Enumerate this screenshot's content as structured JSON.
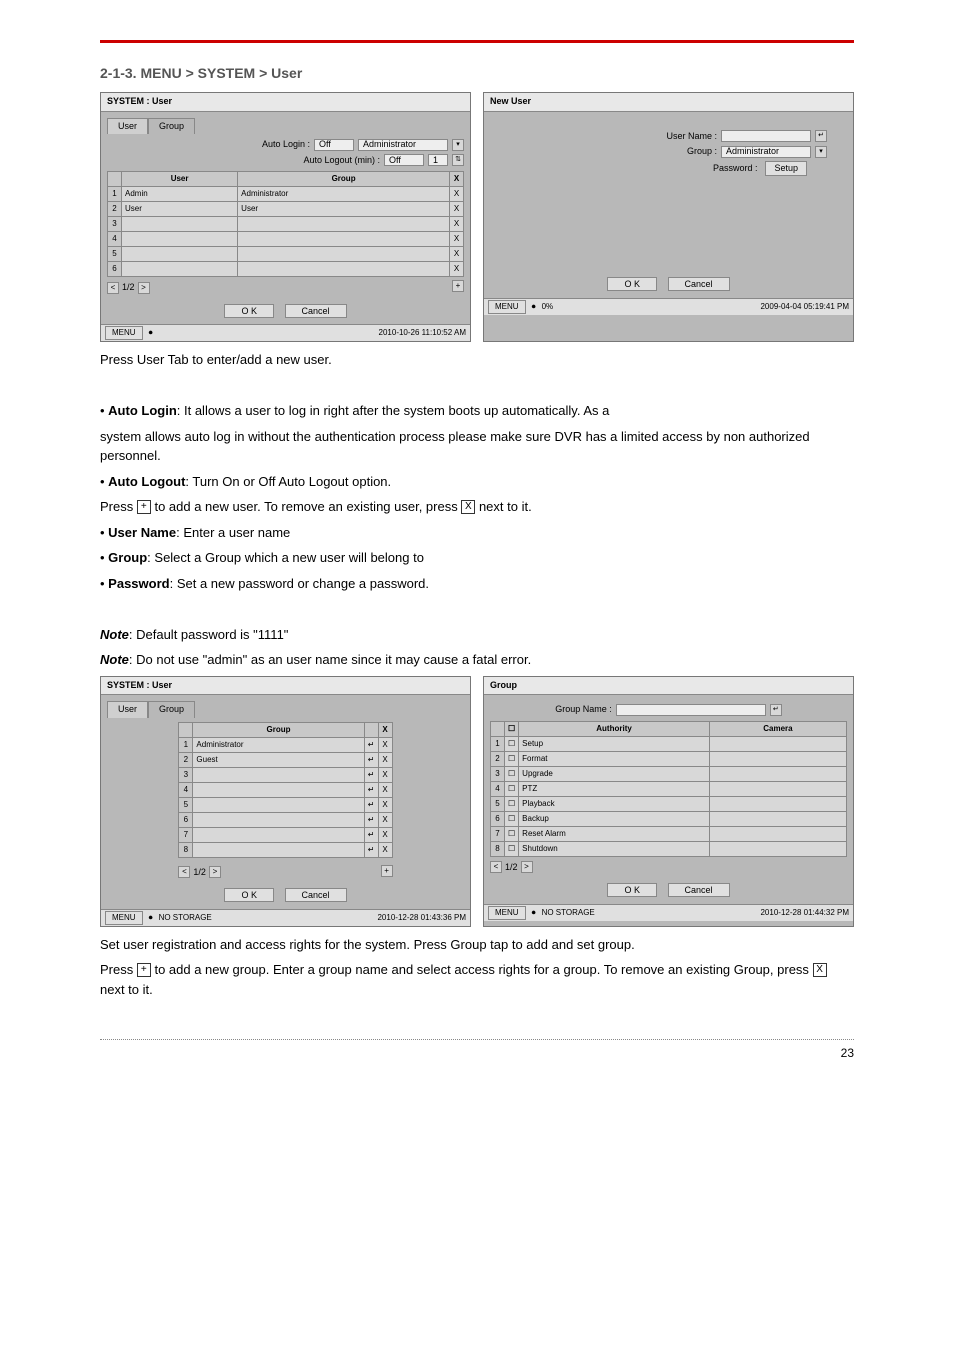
{
  "section_title": "2-1-3. MENU > SYSTEM > User",
  "shot1": {
    "title": "SYSTEM : User",
    "tab_user": "User",
    "tab_group": "Group",
    "auto_login_label": "Auto Login :",
    "auto_login_val": "Off",
    "auto_login_group": "Administrator",
    "auto_logout_label": "Auto Logout (min) :",
    "auto_logout_val": "Off",
    "auto_logout_num": "1",
    "col_user": "User",
    "col_group": "Group",
    "rows": [
      {
        "n": "1",
        "user": "Admin",
        "group": "Administrator"
      },
      {
        "n": "2",
        "user": "User",
        "group": "User"
      },
      {
        "n": "3",
        "user": "",
        "group": ""
      },
      {
        "n": "4",
        "user": "",
        "group": ""
      },
      {
        "n": "5",
        "user": "",
        "group": ""
      },
      {
        "n": "6",
        "user": "",
        "group": ""
      }
    ],
    "pager": "1/2",
    "ok": "O K",
    "cancel": "Cancel",
    "menu": "MENU",
    "ts": "2010-10-26 11:10:52 AM"
  },
  "shot2": {
    "title": "New User",
    "uname_label": "User Name :",
    "group_label": "Group :",
    "group_val": "Administrator",
    "pw_label": "Password :",
    "pw_btn": "Setup",
    "ok": "O K",
    "cancel": "Cancel",
    "menu": "MENU",
    "pct": "0%",
    "ts": "2009-04-04 05:19:41 PM"
  },
  "para1": "Press User Tab to enter/add a new user.",
  "bullets1": [
    {
      "b": "Auto Login",
      "t": ": It allows a user to log in right after the system boots up automatically. As a"
    }
  ],
  "para2": "system allows auto log in without the authentication process please make sure DVR has a limited access by non authorized personnel.",
  "bullets2": [
    {
      "b": "Auto Logout",
      "t": ": Turn On or Off Auto Logout option."
    }
  ],
  "press_add_1a": "Press ",
  "press_add_1b": " to add a new user. To remove an existing user, press ",
  "press_add_1c": " next to it.",
  "bullets3": [
    {
      "b": "User Name",
      "t": ": Enter a user name"
    },
    {
      "b": "Group",
      "t": ": Select a Group which a new user will belong to"
    },
    {
      "b": "Password",
      "t": ": Set a new password or change a password."
    }
  ],
  "note1_label": "Note",
  "note1": ": Default password is \"1111\"",
  "note2_label": "Note",
  "note2": ": Do not use \"admin\" as an user name since it may cause a fatal error.",
  "shot3": {
    "title": "SYSTEM : User",
    "tab_user": "User",
    "tab_group": "Group",
    "col_group": "Group",
    "rows": [
      {
        "n": "1",
        "g": "Administrator"
      },
      {
        "n": "2",
        "g": "Guest"
      },
      {
        "n": "3",
        "g": ""
      },
      {
        "n": "4",
        "g": ""
      },
      {
        "n": "5",
        "g": ""
      },
      {
        "n": "6",
        "g": ""
      },
      {
        "n": "7",
        "g": ""
      },
      {
        "n": "8",
        "g": ""
      }
    ],
    "pager": "1/2",
    "ok": "O K",
    "cancel": "Cancel",
    "menu": "MENU",
    "storage": "NO STORAGE",
    "ts": "2010-12-28 01:43:36 PM"
  },
  "shot4": {
    "title": "Group",
    "gname_label": "Group Name :",
    "col_auth": "Authority",
    "col_cam": "Camera",
    "rows": [
      {
        "n": "1",
        "a": "Setup"
      },
      {
        "n": "2",
        "a": "Format"
      },
      {
        "n": "3",
        "a": "Upgrade"
      },
      {
        "n": "4",
        "a": "PTZ"
      },
      {
        "n": "5",
        "a": "Playback"
      },
      {
        "n": "6",
        "a": "Backup"
      },
      {
        "n": "7",
        "a": "Reset Alarm"
      },
      {
        "n": "8",
        "a": "Shutdown"
      }
    ],
    "pager": "1/2",
    "ok": "O K",
    "cancel": "Cancel",
    "menu": "MENU",
    "storage": "NO STORAGE",
    "ts": "2010-12-28 01:44:32 PM"
  },
  "para3a": "Set user registration and access rights for the system. Press Group tap to add and set group.",
  "para3b_1": "Press ",
  "para3b_2": " to add a new group. Enter a group name and select access rights for a group. To remove an existing Group, press ",
  "para3b_3": " next to it.",
  "page_number": "23"
}
